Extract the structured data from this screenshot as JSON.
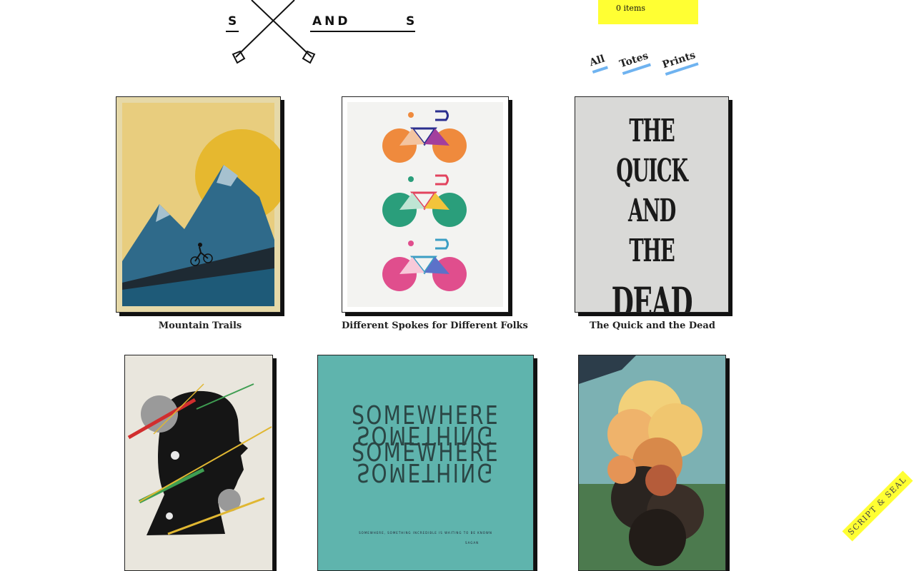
{
  "logo": {
    "letter_left": "S",
    "middle": "AND",
    "letter_right": "S"
  },
  "cart": {
    "label": "0 items"
  },
  "filters": [
    {
      "label": "All"
    },
    {
      "label": "Totes"
    },
    {
      "label": "Prints"
    }
  ],
  "products": [
    {
      "title": "Mountain Trails"
    },
    {
      "title": "Different Spokes for Different Folks"
    },
    {
      "title": "The Quick and the Dead",
      "poster_text": [
        "THE",
        "QUICK",
        "AND THE",
        "DEAD"
      ]
    },
    {
      "title": ""
    },
    {
      "title": "",
      "poster_text": [
        "SOMEWHERE",
        "SOMETHING",
        "SOMEWHERE",
        "SOMETHING"
      ],
      "caption": "SOMEWHERE, SOMETHING INCREDIBLE IS WAITING TO BE KNOWN",
      "author": "SAGAN"
    },
    {
      "title": ""
    }
  ],
  "badge": {
    "label": "SCRIPT & SEAL"
  },
  "colors": {
    "accent_yellow": "#ffff33",
    "underline_blue": "#6fb3f0"
  }
}
